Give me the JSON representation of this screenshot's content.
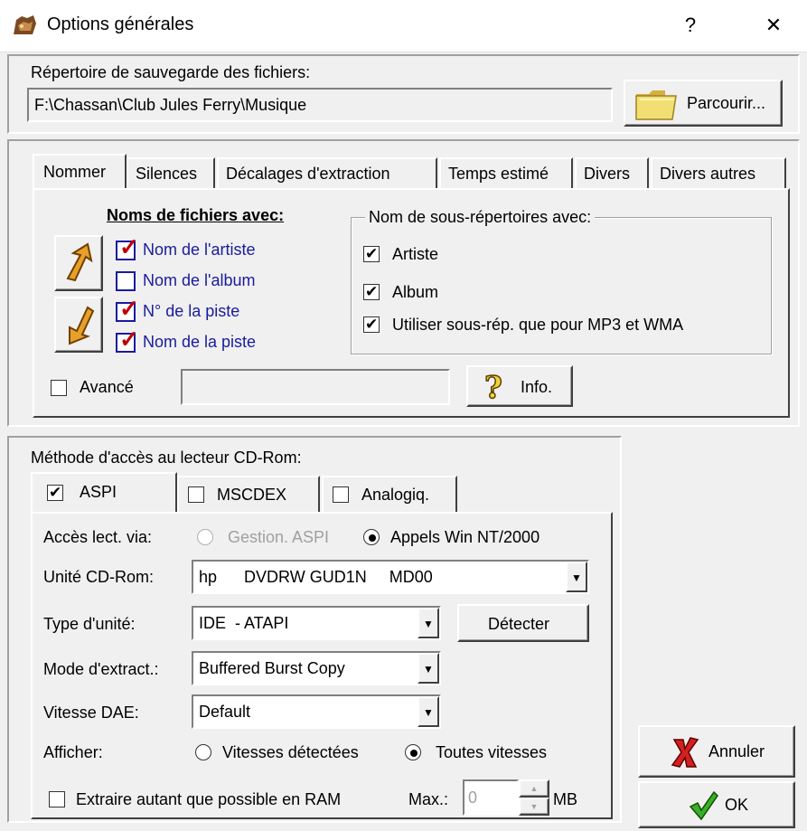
{
  "window": {
    "title": "Options générales",
    "help_glyph": "?",
    "close_glyph": "✕"
  },
  "save": {
    "label": "Répertoire de sauvegarde des fichiers:",
    "path": "F:\\Chassan\\Club Jules Ferry\\Musique",
    "browse_button": "Parcourir..."
  },
  "tabs": [
    "Nommer",
    "Silences",
    "Décalages d'extraction",
    "Temps estimé",
    "Divers",
    "Divers autres"
  ],
  "naming": {
    "files_heading": "Noms de fichiers avec:",
    "file_items": [
      {
        "label": "Nom de l'artiste",
        "checked": true
      },
      {
        "label": "Nom de l'album",
        "checked": false
      },
      {
        "label": "N° de la piste",
        "checked": true
      },
      {
        "label": "Nom de la piste",
        "checked": true
      }
    ],
    "subdir_heading": "Nom de sous-répertoires avec:",
    "subdir_items": [
      {
        "label": "Artiste",
        "checked": true
      },
      {
        "label": "Album",
        "checked": true
      },
      {
        "label": "Utiliser sous-rép. que pour MP3 et WMA",
        "checked": true
      }
    ],
    "advanced_label": "Avancé",
    "advanced_value": "",
    "info_button": "Info."
  },
  "cdrom": {
    "heading": "Méthode d'accès au lecteur CD-Rom:",
    "tabs": [
      {
        "label": "ASPI",
        "checked": true
      },
      {
        "label": "MSCDEX",
        "checked": false
      },
      {
        "label": "Analogiq.",
        "checked": false
      }
    ],
    "access_label": "Accès lect. via:",
    "access_options": [
      "Gestion. ASPI",
      "Appels Win NT/2000"
    ],
    "access_selected": "Appels Win NT/2000",
    "unit_label": "Unité CD-Rom:",
    "unit_value": "hp      DVDRW GUD1N     MD00",
    "type_label": "Type d'unité:",
    "type_value": "IDE  - ATAPI",
    "detect_button": "Détecter",
    "mode_label": "Mode d'extract.:",
    "mode_value": "Buffered Burst Copy",
    "speed_label": "Vitesse DAE:",
    "speed_value": "Default",
    "display_label": "Afficher:",
    "display_options": [
      "Vitesses détectées",
      "Toutes vitesses"
    ],
    "display_selected": "Toutes vitesses",
    "ram_label": "Extraire autant que possible en RAM",
    "ram_checked": false,
    "max_label": "Max.:",
    "max_value": "0",
    "max_unit": "MB"
  },
  "buttons": {
    "cancel": "Annuler",
    "ok": "OK"
  },
  "icons": {
    "app": "app-icon",
    "folder": "folder-icon",
    "up": "arrow-up-icon",
    "down": "arrow-down-icon",
    "info": "question-icon",
    "cancel": "red-x-icon",
    "ok": "green-check-icon"
  }
}
